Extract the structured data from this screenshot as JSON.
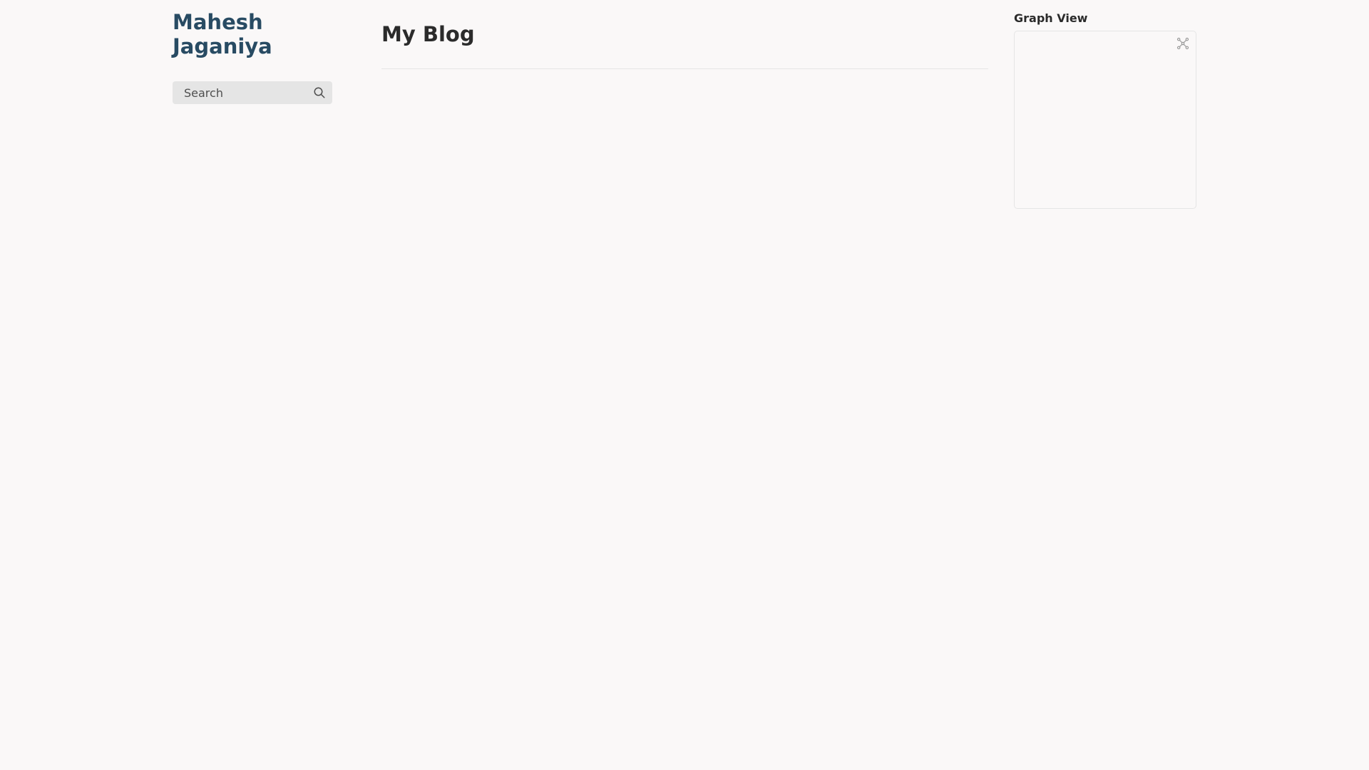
{
  "site": {
    "title": "Mahesh Jaganiya"
  },
  "search": {
    "placeholder": "Search",
    "icon": "search-icon"
  },
  "main": {
    "title": "My Blog"
  },
  "graph": {
    "heading": "Graph View",
    "expand_icon": "global-graph-icon"
  },
  "colors": {
    "background": "#faf8f8",
    "site_title": "#284b63",
    "text": "#2b2b2b",
    "search_bg": "#e5e5e5",
    "border": "#e5e5e5"
  }
}
